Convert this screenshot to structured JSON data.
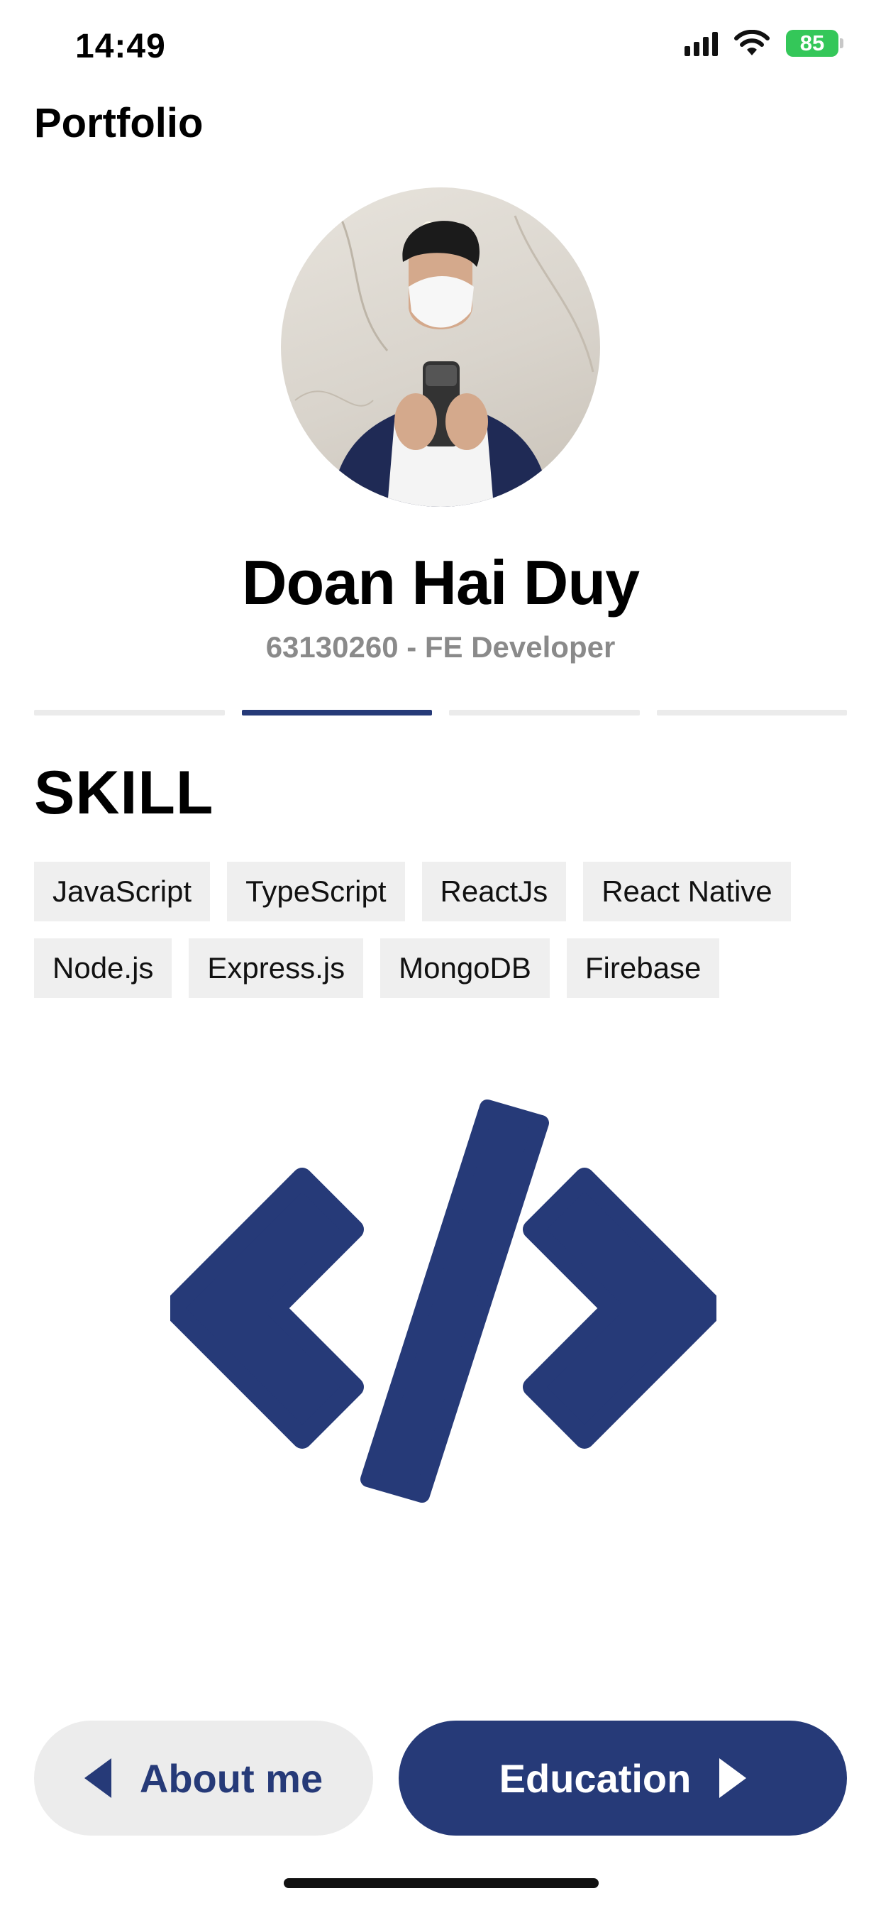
{
  "status_bar": {
    "time": "14:49",
    "battery": "85",
    "icons": [
      "signal-icon",
      "wifi-icon",
      "battery-charging-icon"
    ]
  },
  "header": {
    "title": "Portfolio"
  },
  "profile": {
    "name": "Doan Hai Duy",
    "subtitle": "63130260 - FE Developer",
    "avatar_icon": "profile-photo"
  },
  "progress": {
    "total_steps": 4,
    "current_step": 2
  },
  "section": {
    "title": "SKILL",
    "skills": [
      "JavaScript",
      "TypeScript",
      "ReactJs",
      "React Native",
      "Node.js",
      "Express.js",
      "MongoDB",
      "Firebase"
    ],
    "illustration_icon": "code-icon"
  },
  "navigation": {
    "prev_label": "About me",
    "next_label": "Education"
  },
  "colors": {
    "accent": "#263a78",
    "chip_bg": "#efefef",
    "prev_bg": "#ececec",
    "battery": "#34c759"
  }
}
